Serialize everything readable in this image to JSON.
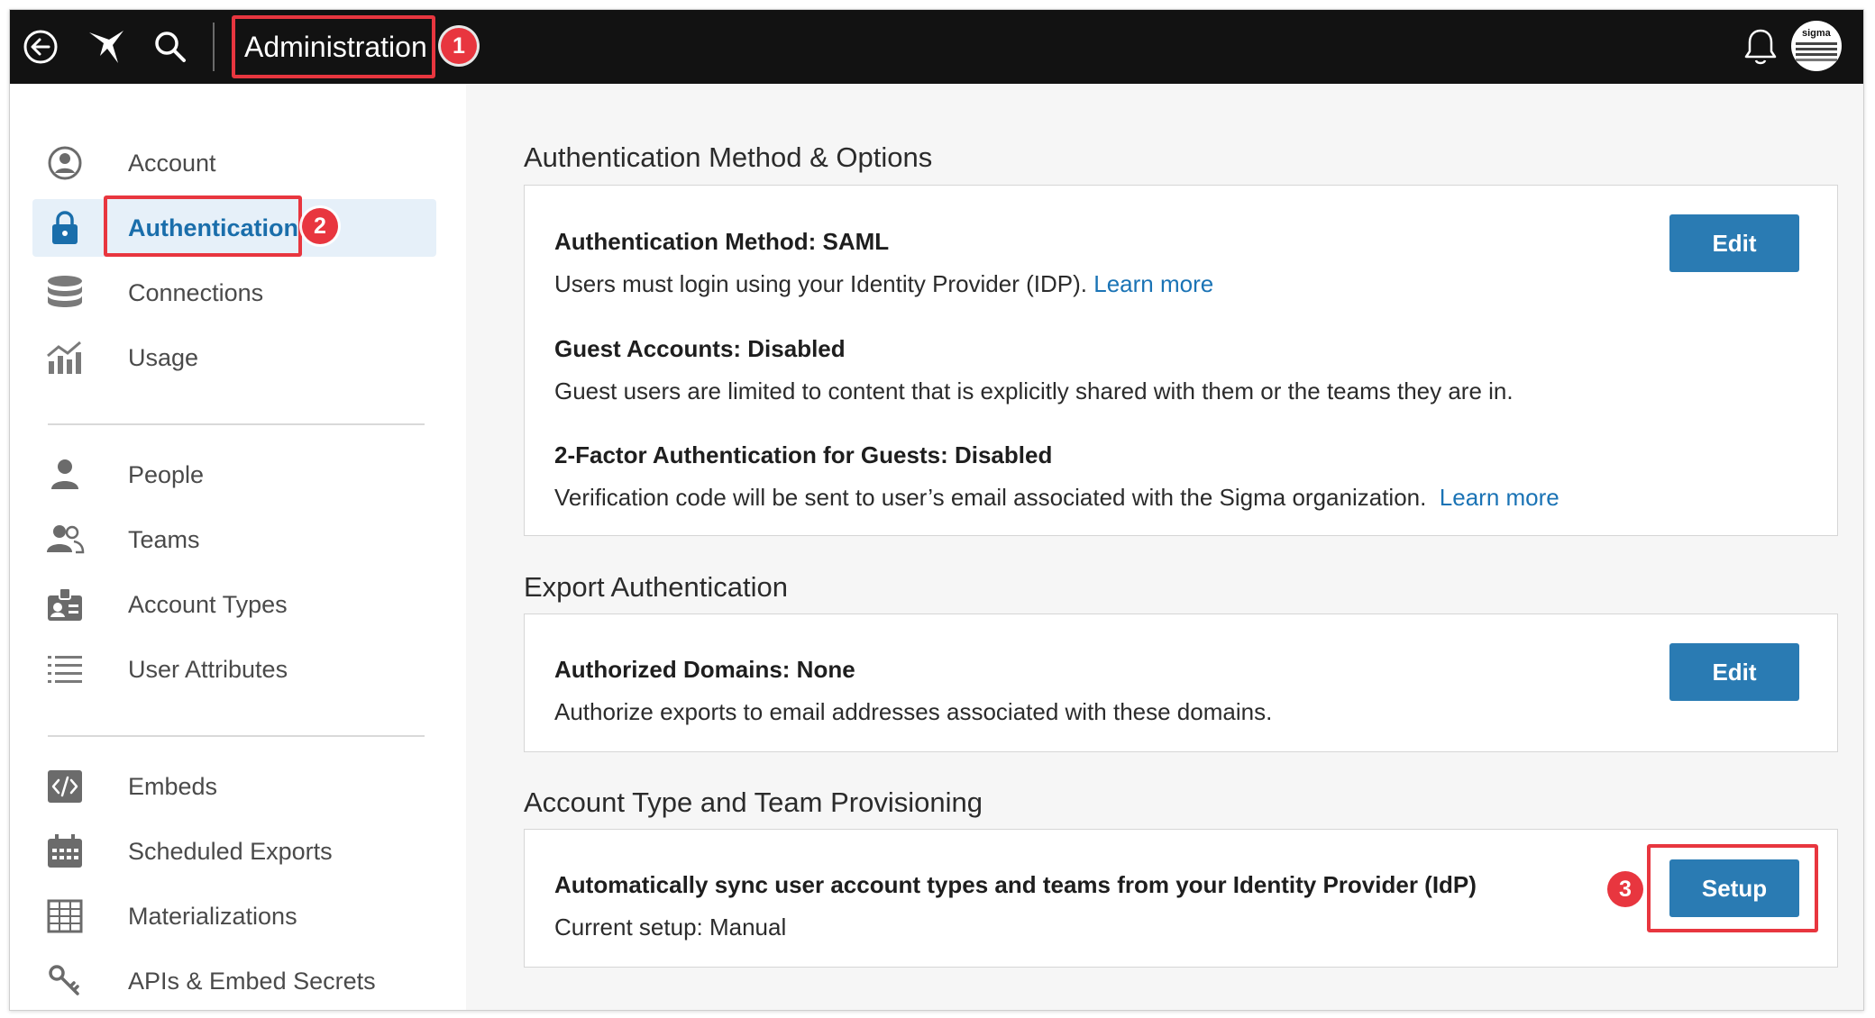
{
  "topbar": {
    "title": "Administration",
    "icons": [
      "back-arrow-icon",
      "sigma-logo-icon",
      "search-icon",
      "bell-icon"
    ],
    "avatar_brand": "sigma"
  },
  "annotations": [
    "1",
    "2",
    "3"
  ],
  "sidebar": {
    "group1": [
      {
        "label": "Account",
        "icon": "user-circle-icon"
      },
      {
        "label": "Authentication",
        "icon": "lock-icon",
        "active": true
      },
      {
        "label": "Connections",
        "icon": "database-icon"
      },
      {
        "label": "Usage",
        "icon": "usage-chart-icon"
      }
    ],
    "group2": [
      {
        "label": "People",
        "icon": "person-icon"
      },
      {
        "label": "Teams",
        "icon": "team-icon"
      },
      {
        "label": "Account Types",
        "icon": "id-badge-icon"
      },
      {
        "label": "User Attributes",
        "icon": "list-icon"
      }
    ],
    "group3": [
      {
        "label": "Embeds",
        "icon": "code-icon"
      },
      {
        "label": "Scheduled Exports",
        "icon": "calendar-icon"
      },
      {
        "label": "Materializations",
        "icon": "table-grid-icon"
      },
      {
        "label": "APIs & Embed Secrets",
        "icon": "key-icon"
      }
    ]
  },
  "main": {
    "auth_method": {
      "section_title": "Authentication Method & Options",
      "method_heading": "Authentication Method: SAML",
      "method_text": "Users must login using your Identity Provider (IDP).",
      "method_link": "Learn more",
      "guest_heading": "Guest Accounts: Disabled",
      "guest_text": "Guest users are limited to content that is explicitly shared with them or the teams they are in.",
      "twofa_heading": "2-Factor Authentication for Guests: Disabled",
      "twofa_text": "Verification code will be sent to user’s email associated with the Sigma organization.",
      "twofa_link": "Learn more",
      "edit_label": "Edit"
    },
    "export_auth": {
      "section_title": "Export Authentication",
      "heading": "Authorized Domains: None",
      "text": "Authorize exports to email addresses associated with these domains.",
      "edit_label": "Edit"
    },
    "provisioning": {
      "section_title": "Account Type and Team Provisioning",
      "heading": "Automatically sync user account types and teams from your Identity Provider (IdP)",
      "text": "Current setup: Manual",
      "setup_label": "Setup"
    }
  },
  "colors": {
    "topbar": "#121212",
    "accent": "#2a7bb3",
    "link": "#1a73b5",
    "callout": "#e8363f",
    "active_bg": "#e6f0f9"
  }
}
